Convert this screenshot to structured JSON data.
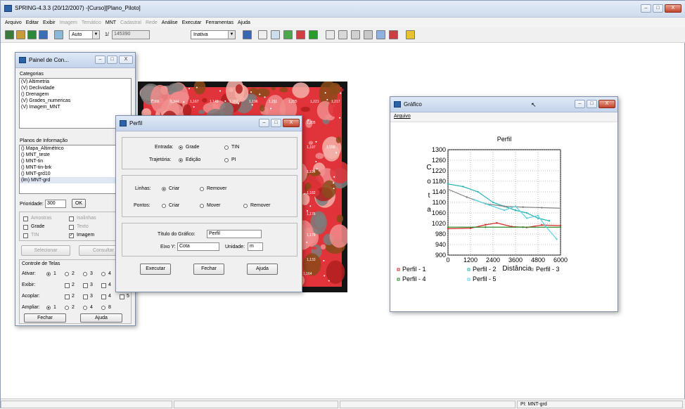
{
  "app": {
    "title": "SPRING-4.3.3 (20/12/2007) -[Curso][Plano_Piloto]",
    "window_buttons": [
      "–",
      "□",
      "X"
    ]
  },
  "menubar": [
    {
      "label": "Arquivo",
      "enabled": true
    },
    {
      "label": "Editar",
      "enabled": true
    },
    {
      "label": "Exibir",
      "enabled": true
    },
    {
      "label": "Imagem",
      "enabled": false
    },
    {
      "label": "Temático",
      "enabled": false
    },
    {
      "label": "MNT",
      "enabled": true
    },
    {
      "label": "Cadastral",
      "enabled": false
    },
    {
      "label": "Rede",
      "enabled": false
    },
    {
      "label": "Análise",
      "enabled": true
    },
    {
      "label": "Executar",
      "enabled": true
    },
    {
      "label": "Ferramentas",
      "enabled": true
    },
    {
      "label": "Ajuda",
      "enabled": true
    }
  ],
  "toolbar": {
    "scale_mode": "Auto",
    "scale_prefix": "1/",
    "scale_value": "145390",
    "mode_select": "Inativa"
  },
  "colors": {
    "map_red": "#e0333a",
    "map_pink": "#f08c8c",
    "map_brown": "#8a4a1a",
    "map_gray": "#7d7d7d",
    "perfil1": "#d92a2a",
    "perfil2": "#2ab5b5",
    "perfil3": "#808080",
    "perfil4": "#2a8a2a",
    "perfil5": "#5fd0e0"
  },
  "painel": {
    "title": "Painel de Con...",
    "window_buttons": [
      "–",
      "□",
      "X"
    ],
    "categorias_label": "Categorias",
    "categorias": [
      "(V) Altimetria",
      "(V) Declividade",
      "() Drenagem",
      "(V) Grades_numericas",
      "(V) Imagem_MNT"
    ],
    "planos_label": "Planos de Informação",
    "planos": [
      "() Mapa_Altimétrico",
      "() MNT_teste",
      "() MNT-tin",
      "() MNT-tin-brk",
      "() MNT-grd10",
      "(lm) MNT-grd"
    ],
    "prioridade_label": "Prioridade:",
    "prioridade_value": "300",
    "ok_button": "OK",
    "checks": [
      {
        "label": "Amostras",
        "checked": false,
        "enabled": false
      },
      {
        "label": "Isolinhas",
        "checked": false,
        "enabled": false
      },
      {
        "label": "Grade",
        "checked": false,
        "enabled": true
      },
      {
        "label": "Texto",
        "checked": false,
        "enabled": false
      },
      {
        "label": "TIN",
        "checked": false,
        "enabled": false
      },
      {
        "label": "Imagem",
        "checked": true,
        "enabled": true
      }
    ],
    "selecionar_button": "Selecionar",
    "consultar_button": "Consultar",
    "controle_label": "Controle de Telas",
    "ativar_label": "Ativar:",
    "exibir_label": "Exibir:",
    "acoplar_label": "Acoplar:",
    "ampliar_label": "Ampliar:",
    "nums": [
      "1",
      "2",
      "3",
      "4",
      "5"
    ],
    "ampliar_nums": [
      "1",
      "2",
      "4",
      "8"
    ],
    "fechar_button": "Fechar",
    "ajuda_button": "Ajuda"
  },
  "map": {
    "labels": [
      "1,366",
      "1,344",
      "1,167",
      "1,149",
      "1,162",
      "1,196",
      "1,211",
      "1,225",
      "1,221",
      "1,217",
      "1,205",
      "1,197",
      "1,194",
      "1,182",
      "1,176",
      "1,178",
      "1,133",
      "1,164",
      "1,158"
    ]
  },
  "perfil": {
    "title": "Perfil",
    "entrada_label": "Entrada:",
    "entrada_grade": "Grade",
    "entrada_tin": "TIN",
    "trajetoria_label": "Trajetória:",
    "traj_edicao": "Edição",
    "traj_pi": "PI",
    "linhas_label": "Linhas:",
    "linhas_criar": "Criar",
    "linhas_remover": "Remover",
    "pontos_label": "Pontos:",
    "pontos_criar": "Criar",
    "pontos_mover": "Mover",
    "pontos_remover": "Remover",
    "titulo_label": "Título do Gráfico:",
    "titulo_value": "Perfil",
    "eixoy_label": "Eixo Y:",
    "eixoy_value": "Cota",
    "unidade_label": "Unidade:",
    "unidade_value": "m",
    "executar_button": "Executar",
    "fechar_button": "Fechar",
    "ajuda_button": "Ajuda"
  },
  "grafico": {
    "title": "Gráfico",
    "menu_arquivo": "Arquivo"
  },
  "chart_data": {
    "type": "line",
    "title": "Perfil",
    "xlabel": "Distância",
    "ylabel": "Cota",
    "xlim": [
      0,
      6000
    ],
    "ylim": [
      900,
      1300
    ],
    "x_ticks": [
      "0",
      "1200",
      "2400",
      "3600",
      "4800",
      "6000"
    ],
    "y_ticks": [
      "1300",
      "1260",
      "1220",
      "1180",
      "1140",
      "1100",
      "1060",
      "1020",
      "980",
      "940",
      "900"
    ],
    "grid": true,
    "legend_position": "bottom",
    "series": [
      {
        "name": "Perfil - 1",
        "color": "#d92a2a",
        "x": [
          0,
          1200,
          2000,
          2600,
          3400,
          4200,
          5000,
          6000
        ],
        "y": [
          1000,
          1002,
          1015,
          1022,
          1008,
          1005,
          1014,
          1012
        ]
      },
      {
        "name": "Perfil - 2",
        "color": "#2ab5b5",
        "x": [
          0,
          800,
          1600,
          2400,
          3000,
          3600,
          4200,
          4800,
          5400
        ],
        "y": [
          1170,
          1160,
          1140,
          1100,
          1085,
          1070,
          1060,
          1040,
          1030
        ]
      },
      {
        "name": "Perfil - 3",
        "color": "#808080",
        "x": [
          0,
          1000,
          2000,
          3000,
          4000,
          5000,
          6000
        ],
        "y": [
          1150,
          1120,
          1095,
          1085,
          1082,
          1080,
          1078
        ]
      },
      {
        "name": "Perfil - 4",
        "color": "#2a8a2a",
        "x": [
          0,
          2000,
          4000,
          6000
        ],
        "y": [
          1006,
          1006,
          1006,
          1006
        ]
      },
      {
        "name": "Perfil - 5",
        "color": "#5fd0e0",
        "x": [
          1400,
          2200,
          3000,
          3600,
          4200,
          4800,
          5200,
          5800
        ],
        "y": [
          1110,
          1090,
          1070,
          1085,
          1040,
          1050,
          1010,
          960
        ]
      }
    ]
  },
  "status": {
    "pi": "PI: MNT-grd"
  }
}
